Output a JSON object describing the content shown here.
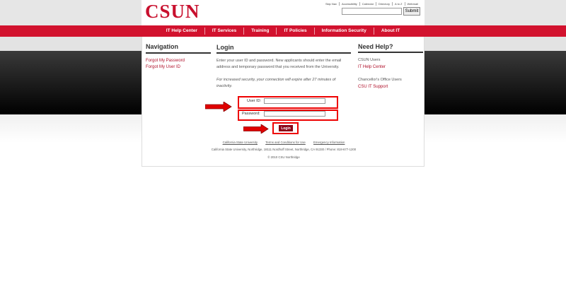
{
  "header": {
    "logo": "CSUN",
    "utility_links": [
      "Skip Nav",
      "Accessibility",
      "Calendar",
      "Directory",
      "A to Z",
      "Webmail"
    ],
    "search_value": "",
    "submit_label": "Submit"
  },
  "nav": {
    "items": [
      "IT Help Center",
      "IT Services",
      "Training",
      "IT Policies",
      "Information Security",
      "About IT"
    ]
  },
  "left": {
    "title": "Navigation",
    "links": [
      "Forgot My Password",
      "Forgot My User ID"
    ]
  },
  "login": {
    "title": "Login",
    "intro": "Enter your user ID and password. New applicants should enter the email address and temporary password that you received from the University.",
    "note": "For increased security, your connection will expire after 27 minutes of inactivity.",
    "userid_label": "User ID:",
    "userid_value": "",
    "password_label": "Password:",
    "password_value": "",
    "button_label": "Login"
  },
  "help": {
    "title": "Need Help?",
    "group1_label": "CSUN Users",
    "group1_link": "IT Help Center",
    "group2_label": "Chancellor's Office Users",
    "group2_link": "CSU IT Support"
  },
  "footer": {
    "links": [
      "California State University",
      "Terms and Conditions for Use",
      "Emergency Information"
    ],
    "address": "California State University, Northridge, 18111 Nordhoff Street, Northridge, CA 91330 / Phone: 818-677-1200",
    "copyright": "© 2010 CSU Northridge"
  },
  "colors": {
    "brand_red": "#d2122e",
    "annotation_red": "#e00000",
    "login_button": "#8b0016"
  },
  "icons": [
    "arrow-right-icon",
    "arrow-right-icon",
    "arrow-right-icon"
  ]
}
